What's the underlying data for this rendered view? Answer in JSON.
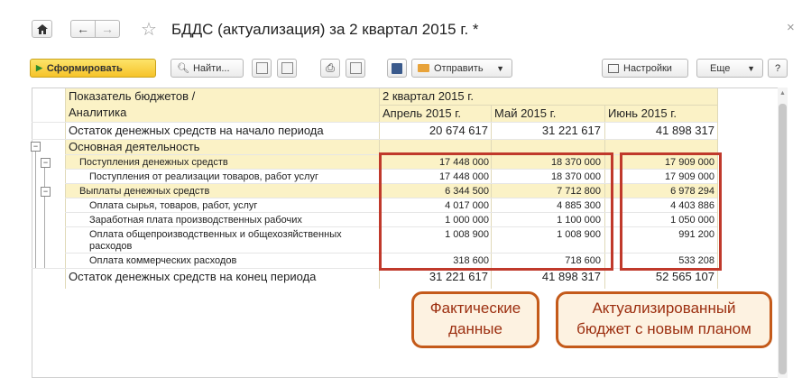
{
  "window": {
    "title": "БДДС (актуализация)  за 2 квартал 2015 г. *",
    "close": "×"
  },
  "toolbar": {
    "generate": "Сформировать",
    "find": "Найти...",
    "send": "Отправить",
    "settings": "Настройки",
    "more": "Еще",
    "help": "?"
  },
  "report": {
    "col_header_line1": "Показатель бюджетов /",
    "col_header_line2": "Аналитика",
    "period": "2 квартал 2015 г.",
    "months": [
      "Апрель 2015 г.",
      "Май 2015 г.",
      "Июнь 2015 г."
    ],
    "rows": [
      {
        "label": "Остаток денежных средств на начало периода",
        "v": [
          "20 674 617",
          "31 221 617",
          "41 898 317"
        ]
      },
      {
        "label": "Основная деятельность",
        "v": [
          "",
          "",
          ""
        ]
      },
      {
        "label": "Поступления денежных средств",
        "v": [
          "17 448 000",
          "18 370 000",
          "17 909 000"
        ]
      },
      {
        "label": "Поступления от реализации товаров, работ услуг",
        "v": [
          "17 448 000",
          "18 370 000",
          "17 909 000"
        ]
      },
      {
        "label": "Выплаты денежных средств",
        "v": [
          "6 344 500",
          "7 712 800",
          "6 978 294"
        ]
      },
      {
        "label": "Оплата сырья, товаров, работ, услуг",
        "v": [
          "4 017 000",
          "4 885 300",
          "4 403 886"
        ]
      },
      {
        "label": "Заработная плата производственных рабочих",
        "v": [
          "1 000 000",
          "1 100 000",
          "1 050 000"
        ]
      },
      {
        "label": "Оплата общепроизводственных и общехозяйственных",
        "label2": "расходов",
        "v": [
          "1 008 900",
          "1 008 900",
          "991 200"
        ]
      },
      {
        "label": "Оплата коммерческих расходов",
        "v": [
          "318 600",
          "718 600",
          "533 208"
        ]
      },
      {
        "label": "Остаток денежных средств на конец периода",
        "v": [
          "31 221 617",
          "41 898 317",
          "52 565 107"
        ]
      }
    ]
  },
  "callouts": {
    "actual_line1": "Фактические",
    "actual_line2": "данные",
    "plan_line1": "Актуализированный",
    "plan_line2": "бюджет с новым планом"
  },
  "colors": {
    "accent_red": "#c0392b",
    "callout_border": "#c45a1a",
    "header_bg": "#fbf2c6"
  }
}
